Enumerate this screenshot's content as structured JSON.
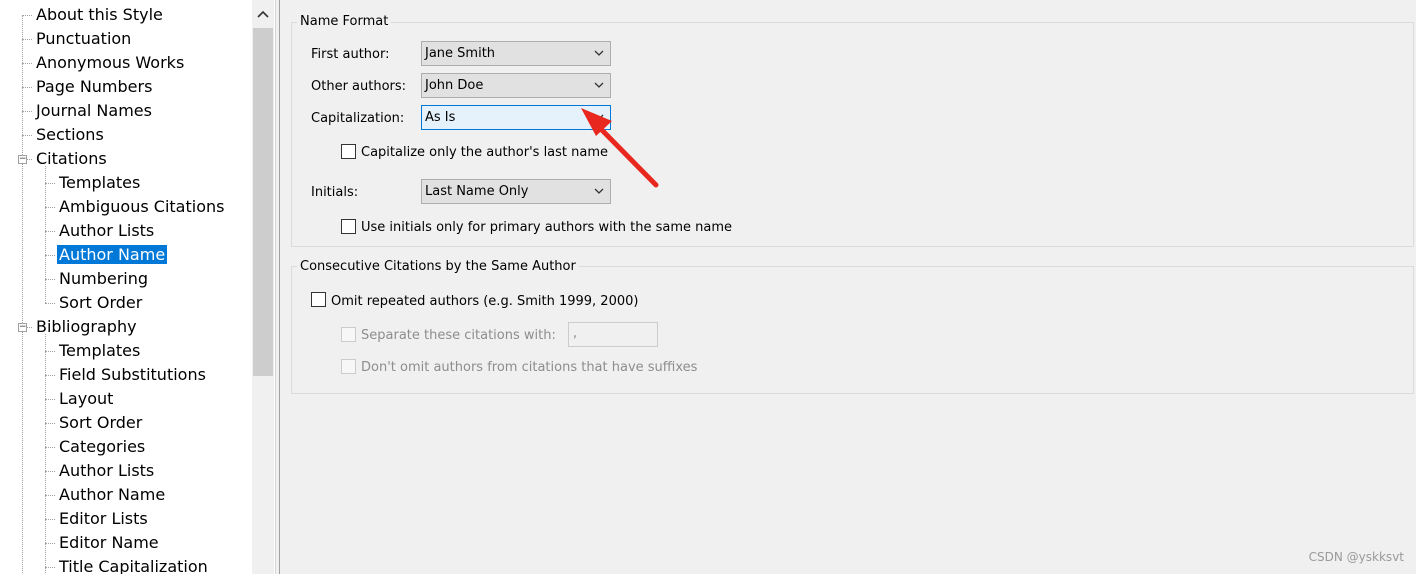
{
  "tree": {
    "items": [
      {
        "label": "About this Style",
        "level": 0
      },
      {
        "label": "Punctuation",
        "level": 0
      },
      {
        "label": "Anonymous Works",
        "level": 0
      },
      {
        "label": "Page Numbers",
        "level": 0
      },
      {
        "label": "Journal Names",
        "level": 0
      },
      {
        "label": "Sections",
        "level": 0
      },
      {
        "label": "Citations",
        "level": 0,
        "expander": "minus"
      },
      {
        "label": "Templates",
        "level": 1
      },
      {
        "label": "Ambiguous Citations",
        "level": 1
      },
      {
        "label": "Author Lists",
        "level": 1
      },
      {
        "label": "Author Name",
        "level": 1,
        "selected": true
      },
      {
        "label": "Numbering",
        "level": 1
      },
      {
        "label": "Sort Order",
        "level": 1
      },
      {
        "label": "Bibliography",
        "level": 0,
        "expander": "minus"
      },
      {
        "label": "Templates",
        "level": 1
      },
      {
        "label": "Field Substitutions",
        "level": 1
      },
      {
        "label": "Layout",
        "level": 1
      },
      {
        "label": "Sort Order",
        "level": 1
      },
      {
        "label": "Categories",
        "level": 1
      },
      {
        "label": "Author Lists",
        "level": 1
      },
      {
        "label": "Author Name",
        "level": 1
      },
      {
        "label": "Editor Lists",
        "level": 1
      },
      {
        "label": "Editor Name",
        "level": 1
      },
      {
        "label": "Title Capitalization",
        "level": 1
      }
    ]
  },
  "name_format": {
    "title": "Name Format",
    "first_author_label": "First author:",
    "first_author_value": "Jane Smith",
    "other_authors_label": "Other authors:",
    "other_authors_value": "John Doe",
    "capitalization_label": "Capitalization:",
    "capitalization_value": "As Is",
    "cap_last_name_label": "Capitalize only the author's last name",
    "cap_last_name_checked": false,
    "initials_label": "Initials:",
    "initials_value": "Last Name Only",
    "use_initials_label": "Use initials only for primary authors with the same name",
    "use_initials_checked": false
  },
  "consecutive": {
    "title": "Consecutive Citations by the Same Author",
    "omit_label": "Omit repeated authors (e.g. Smith 1999, 2000)",
    "omit_checked": false,
    "separate_label": "Separate these citations with:",
    "separate_value": ",",
    "dont_omit_label": "Don't omit authors from citations that have suffixes"
  },
  "watermark": "CSDN @yskksvt",
  "colors": {
    "selection": "#0078d7",
    "annotation_arrow": "#e8281e"
  }
}
